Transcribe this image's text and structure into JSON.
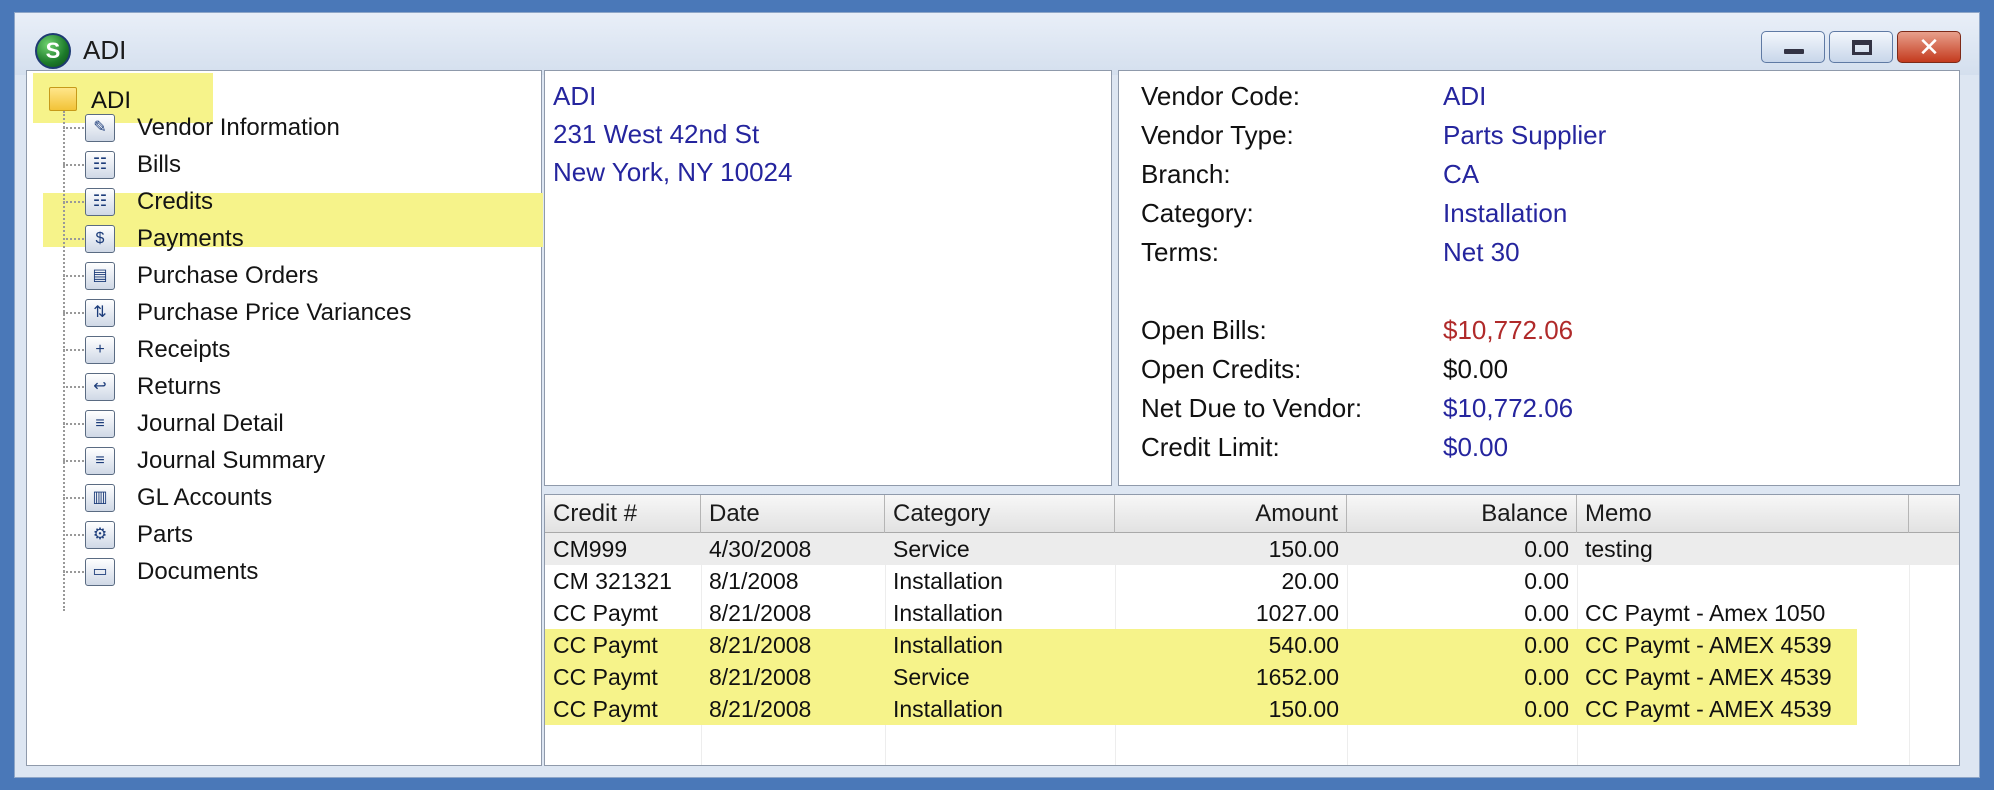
{
  "window": {
    "title": "ADI",
    "app_icon_letter": "S",
    "close_glyph": "✕"
  },
  "tree": {
    "root_label": "ADI",
    "items": [
      {
        "label": "Vendor Information",
        "icon": "vendor-info-icon",
        "glyph": "✎"
      },
      {
        "label": "Bills",
        "icon": "bills-icon",
        "glyph": "☷"
      },
      {
        "label": "Credits",
        "icon": "credits-icon",
        "glyph": "☷"
      },
      {
        "label": "Payments",
        "icon": "payments-icon",
        "glyph": "$"
      },
      {
        "label": "Purchase Orders",
        "icon": "purchase-orders-icon",
        "glyph": "▤"
      },
      {
        "label": "Purchase Price Variances",
        "icon": "price-variance-icon",
        "glyph": "⇅"
      },
      {
        "label": "Receipts",
        "icon": "receipts-icon",
        "glyph": "+"
      },
      {
        "label": "Returns",
        "icon": "returns-icon",
        "glyph": "↩"
      },
      {
        "label": "Journal Detail",
        "icon": "journal-detail-icon",
        "glyph": "≡"
      },
      {
        "label": "Journal Summary",
        "icon": "journal-summary-icon",
        "glyph": "≡"
      },
      {
        "label": "GL Accounts",
        "icon": "gl-accounts-icon",
        "glyph": "▥"
      },
      {
        "label": "Parts",
        "icon": "parts-gear-icon",
        "glyph": "⚙"
      },
      {
        "label": "Documents",
        "icon": "documents-icon",
        "glyph": "▭"
      }
    ],
    "selected": "Credits"
  },
  "address": {
    "name": "ADI",
    "street": "231 West 42nd St",
    "city_state_zip": "New York, NY  10024"
  },
  "info": {
    "vendor_code_label": "Vendor Code:",
    "vendor_code": "ADI",
    "vendor_type_label": "Vendor Type:",
    "vendor_type": "Parts Supplier",
    "branch_label": "Branch:",
    "branch": "CA",
    "category_label": "Category:",
    "category": "Installation",
    "terms_label": "Terms:",
    "terms": "Net 30",
    "open_bills_label": "Open Bills:",
    "open_bills": "$10,772.06",
    "open_credits_label": "Open Credits:",
    "open_credits": "$0.00",
    "net_due_label": "Net Due to Vendor:",
    "net_due": "$10,772.06",
    "credit_limit_label": "Credit Limit:",
    "credit_limit": "$0.00",
    "colors": {
      "value": "#25259e",
      "open_bills": "#b02a2a",
      "open_credits": "#111111"
    }
  },
  "grid": {
    "headers": {
      "credit": "Credit #",
      "date": "Date",
      "category": "Category",
      "amount": "Amount",
      "balance": "Balance",
      "memo": "Memo"
    },
    "rows": [
      {
        "credit": "CM999",
        "date": "4/30/2008",
        "category": "Service",
        "amount": "150.00",
        "balance": "0.00",
        "memo": "testing",
        "highlight": false
      },
      {
        "credit": "CM 321321",
        "date": "8/1/2008",
        "category": "Installation",
        "amount": "20.00",
        "balance": "0.00",
        "memo": "",
        "highlight": false
      },
      {
        "credit": "CC Paymt",
        "date": "8/21/2008",
        "category": "Installation",
        "amount": "1027.00",
        "balance": "0.00",
        "memo": "CC Paymt - Amex 1050",
        "highlight": false
      },
      {
        "credit": "CC Paymt",
        "date": "8/21/2008",
        "category": "Installation",
        "amount": "540.00",
        "balance": "0.00",
        "memo": "CC Paymt - AMEX 4539",
        "highlight": true
      },
      {
        "credit": "CC Paymt",
        "date": "8/21/2008",
        "category": "Service",
        "amount": "1652.00",
        "balance": "0.00",
        "memo": "CC Paymt - AMEX 4539",
        "highlight": true
      },
      {
        "credit": "CC Paymt",
        "date": "8/21/2008",
        "category": "Installation",
        "amount": "150.00",
        "balance": "0.00",
        "memo": "CC Paymt - AMEX 4539",
        "highlight": true
      }
    ],
    "highlight_color": "#f6f38a"
  }
}
